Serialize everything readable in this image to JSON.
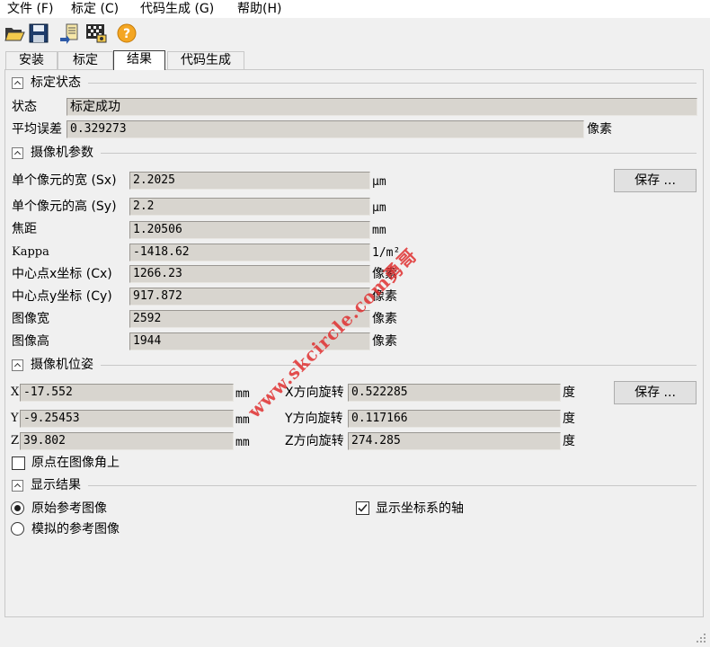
{
  "menu": [
    "文件 (F)",
    "标定 (C)",
    "代码生成 (G)",
    "帮助(H)"
  ],
  "toolbar": {
    "open": "folder-open-icon",
    "save": "save-disk-icon",
    "export": "export-document-icon",
    "calibration": "calibration-board-icon",
    "help": "help-icon"
  },
  "tabs": [
    "安装",
    "标定",
    "结果",
    "代码生成"
  ],
  "calib_status": {
    "title": "标定状态",
    "status_label": "状态",
    "status_value": "标定成功",
    "mean_error_label": "平均误差",
    "mean_error_value": "0.329273",
    "mean_error_unit": "像素"
  },
  "camera_params": {
    "title": "摄像机参数",
    "save_label": "保存 ...",
    "rows": [
      {
        "label": "单个像元的宽 (Sx)",
        "value": "2.2025",
        "unit": "µm"
      },
      {
        "label": "单个像元的高 (Sy)",
        "value": "2.2",
        "unit": "µm"
      },
      {
        "label": "焦距",
        "value": "1.20506",
        "unit": "mm"
      },
      {
        "label": "Kappa",
        "value": "-1418.62",
        "unit": "1/m²"
      },
      {
        "label": "中心点x坐标 (Cx)",
        "value": "1266.23",
        "unit": "像素"
      },
      {
        "label": "中心点y坐标 (Cy)",
        "value": "917.872",
        "unit": "像素"
      },
      {
        "label": "图像宽",
        "value": "2592",
        "unit": "像素"
      },
      {
        "label": "图像高",
        "value": "1944",
        "unit": "像素"
      }
    ]
  },
  "camera_pose": {
    "title": "摄像机位姿",
    "save_label": "保存 ...",
    "rows": [
      {
        "axis": "X",
        "value": "-17.552",
        "unit": "mm",
        "rot_label": "X方向旋转",
        "rot_value": "0.522285",
        "rot_unit": "度"
      },
      {
        "axis": "Y",
        "value": "-9.25453",
        "unit": "mm",
        "rot_label": "Y方向旋转",
        "rot_value": "0.117166",
        "rot_unit": "度"
      },
      {
        "axis": "Z",
        "value": "39.802",
        "unit": "mm",
        "rot_label": "Z方向旋转",
        "rot_value": "274.285",
        "rot_unit": "度"
      }
    ],
    "origin_checkbox": "原点在图像角上"
  },
  "display": {
    "title": "显示结果",
    "radio_original": "原始参考图像",
    "radio_simulated": "模拟的参考图像",
    "checkbox_axes": "显示坐标系的轴"
  },
  "watermark": "www.skcircle.com勇哥"
}
